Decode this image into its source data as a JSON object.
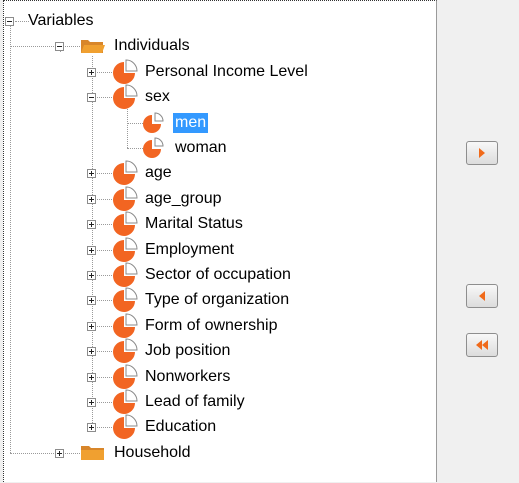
{
  "tree": {
    "nodes": [
      {
        "label": "Variables",
        "level": 0,
        "icon": "none",
        "expander": "minus"
      },
      {
        "label": "Individuals",
        "level": 1,
        "icon": "folder-open-icon",
        "expander": "minus"
      },
      {
        "label": "Personal Income Level",
        "level": 2,
        "icon": "pie-chart-icon",
        "expander": "plus"
      },
      {
        "label": "sex",
        "level": 2,
        "icon": "pie-chart-icon",
        "expander": "minus"
      },
      {
        "label": "men",
        "level": 3,
        "icon": "pie-slice-icon",
        "expander": "none",
        "selected": true
      },
      {
        "label": "woman",
        "level": 3,
        "icon": "pie-slice-icon",
        "expander": "none"
      },
      {
        "label": "age",
        "level": 2,
        "icon": "pie-chart-icon",
        "expander": "plus"
      },
      {
        "label": "age_group",
        "level": 2,
        "icon": "pie-chart-icon",
        "expander": "plus"
      },
      {
        "label": "Marital Status",
        "level": 2,
        "icon": "pie-chart-icon",
        "expander": "plus"
      },
      {
        "label": "Employment",
        "level": 2,
        "icon": "pie-chart-icon",
        "expander": "plus"
      },
      {
        "label": "Sector of occupation",
        "level": 2,
        "icon": "pie-chart-icon",
        "expander": "plus"
      },
      {
        "label": "Type of organization",
        "level": 2,
        "icon": "pie-chart-icon",
        "expander": "plus"
      },
      {
        "label": "Form of ownership",
        "level": 2,
        "icon": "pie-chart-icon",
        "expander": "plus"
      },
      {
        "label": "Job position",
        "level": 2,
        "icon": "pie-chart-icon",
        "expander": "plus"
      },
      {
        "label": "Nonworkers",
        "level": 2,
        "icon": "pie-chart-icon",
        "expander": "plus"
      },
      {
        "label": "Lead of family",
        "level": 2,
        "icon": "pie-chart-icon",
        "expander": "plus"
      },
      {
        "label": "Education",
        "level": 2,
        "icon": "pie-chart-icon",
        "expander": "plus"
      },
      {
        "label": "Household",
        "level": 1,
        "icon": "folder-closed-icon",
        "expander": "plus"
      }
    ]
  },
  "buttons": [
    {
      "name": "move-right-button",
      "icon": "arrow-right-icon"
    },
    {
      "name": "move-left-button",
      "icon": "arrow-left-icon"
    },
    {
      "name": "move-all-left-button",
      "icon": "double-arrow-left-icon"
    }
  ],
  "colors": {
    "selection": "#3399ff",
    "pie_orange": "#f26522",
    "folder": "#f0a030",
    "arrow": "#f06a1a"
  }
}
